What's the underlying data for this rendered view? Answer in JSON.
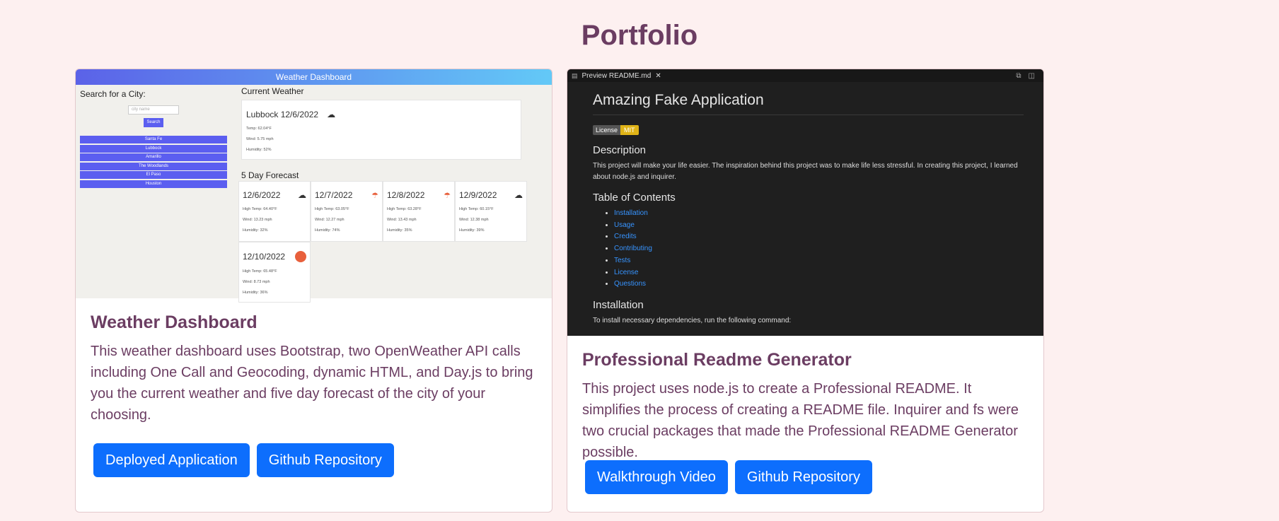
{
  "page": {
    "title": "Portfolio"
  },
  "projects": [
    {
      "title": "Weather Dashboard",
      "description": "This weather dashboard uses Bootstrap, two OpenWeather API calls including One Call and Geocoding, dynamic HTML, and Day.js to bring you the current weather and five day forecast of the city of your choosing.",
      "buttons": [
        "Deployed Application",
        "Github Repository"
      ],
      "preview": {
        "header": "Weather Dashboard",
        "search_heading": "Search for a City:",
        "search_placeholder": "city name",
        "search_button": "Search",
        "cities": [
          "Santa Fe",
          "Lubbock",
          "Amarillo",
          "The Woodlands",
          "El Paso",
          "Houston"
        ],
        "current_heading": "Current Weather",
        "current": {
          "city_date": "Lubbock 12/6/2022",
          "temp": "Temp: 62.04°F",
          "wind": "Wind: 5.75 mph",
          "humidity": "Humidity: 52%"
        },
        "forecast_heading": "5 Day Forecast",
        "forecast": [
          {
            "date": "12/6/2022",
            "high": "High Temp: 64.40°F",
            "wind": "Wind: 13.23 mph",
            "humidity": "Humidity: 32%",
            "icon": "cloud-icon"
          },
          {
            "date": "12/7/2022",
            "high": "High Temp: 63.05°F",
            "wind": "Wind: 12.27 mph",
            "humidity": "Humidity: 74%",
            "icon": "rain-icon"
          },
          {
            "date": "12/8/2022",
            "high": "High Temp: 63.28°F",
            "wind": "Wind: 13.43 mph",
            "humidity": "Humidity: 35%",
            "icon": "rain-icon"
          },
          {
            "date": "12/9/2022",
            "high": "High Temp: 60.15°F",
            "wind": "Wind: 12.38 mph",
            "humidity": "Humidity: 39%",
            "icon": "cloud-icon"
          },
          {
            "date": "12/10/2022",
            "high": "High Temp: 65.48°F",
            "wind": "Wind: 8.73 mph",
            "humidity": "Humidity: 36%",
            "icon": "sun-icon"
          }
        ]
      }
    },
    {
      "title": "Professional Readme Generator",
      "description": "This project uses node.js to create a Professional README. It simplifies the process of creating a README file. Inquirer and fs were two crucial packages that made the Professional README Generator possible.",
      "buttons": [
        "Walkthrough Video",
        "Github Repository"
      ],
      "preview": {
        "tab": "Preview README.md",
        "h1": "Amazing Fake Application",
        "badge_left": "License",
        "badge_right": "MIT",
        "desc_heading": "Description",
        "desc_text": "This project will make your life easier. The inspiration behind this project was to make life less stressful. In creating this project, I learned about node.js and inquirer.",
        "toc_heading": "Table of Contents",
        "toc": [
          "Installation",
          "Usage",
          "Credits",
          "Contributing",
          "Tests",
          "License",
          "Questions"
        ],
        "install_heading": "Installation",
        "install_text": "To install necessary dependencies, run the following command:"
      }
    }
  ],
  "colors": {
    "background": "#fdf0f0",
    "accent": "#6b3d62",
    "button": "#0d6efd"
  }
}
